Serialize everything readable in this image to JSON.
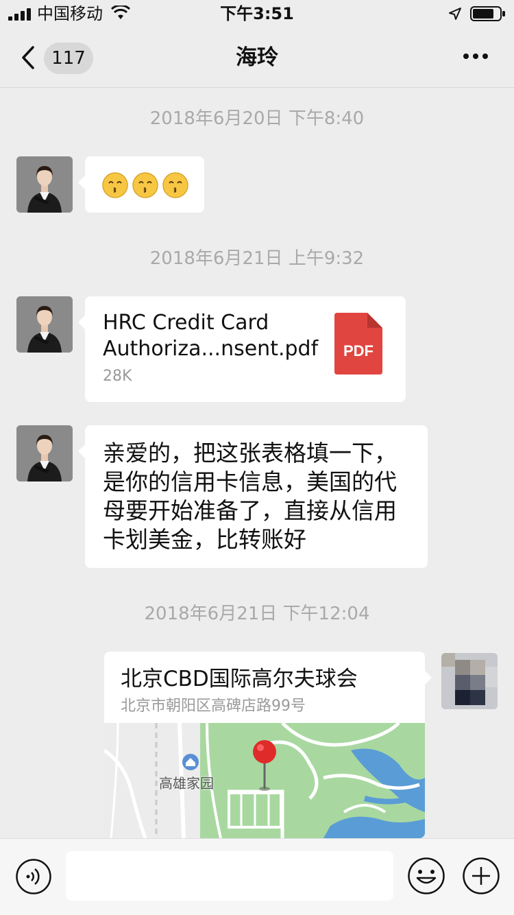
{
  "status_bar": {
    "carrier": "中国移动",
    "time": "下午3:51"
  },
  "nav": {
    "unread_count": "117",
    "title": "海玲"
  },
  "messages": [
    {
      "timestamp": "2018年6月20日 下午8:40"
    },
    {
      "timestamp": "2018年6月21日 上午9:32"
    },
    {
      "file_name": "HRC Credit Card Authoriza...nsent.pdf",
      "file_size": "28K",
      "file_type": "PDF"
    },
    {
      "text": "亲爱的，把这张表格填一下，是你的信用卡信息，美国的代母要开始准备了，直接从信用卡划美金，比转账好"
    },
    {
      "timestamp": "2018年6月21日 下午12:04"
    },
    {
      "location_name": "北京CBD国际高尔夫球会",
      "location_address": "北京市朝阳区高碑店路99号",
      "map_label": "高雄家园"
    }
  ],
  "input": {
    "value": ""
  },
  "colors": {
    "background": "#ededed",
    "bubble": "#ffffff",
    "timestamp": "#a9a9a9",
    "pdf_red": "#e0463f",
    "map_green": "#a8d8a0"
  }
}
